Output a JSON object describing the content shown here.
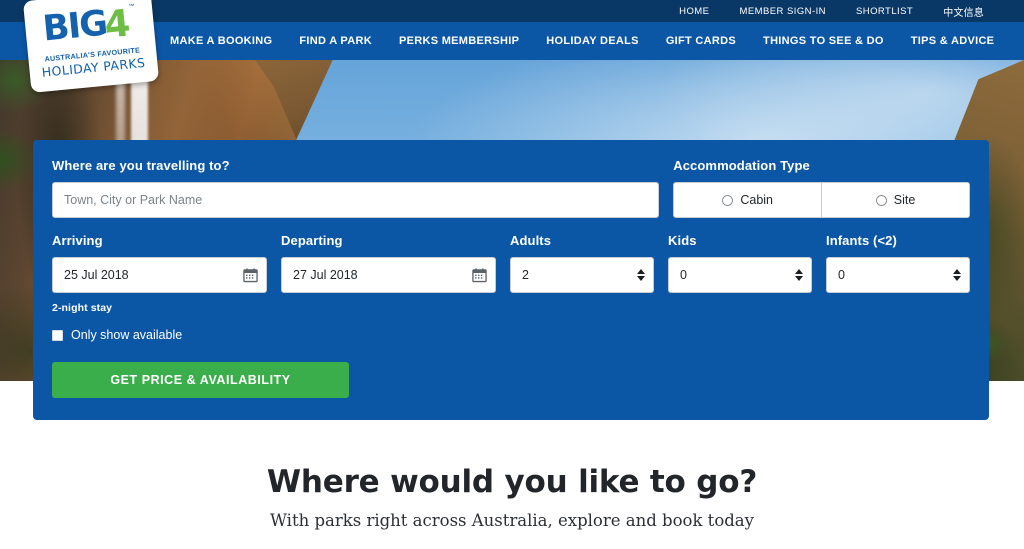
{
  "topbar": {
    "links": [
      {
        "label": "HOME",
        "name": "home"
      },
      {
        "label": "MEMBER SIGN-IN",
        "name": "member-sign-in"
      },
      {
        "label": "SHORTLIST",
        "name": "shortlist"
      },
      {
        "label": "中文信息",
        "name": "chinese-info"
      }
    ]
  },
  "mainnav": {
    "links": [
      {
        "label": "MAKE A BOOKING",
        "name": "make-a-booking"
      },
      {
        "label": "FIND A PARK",
        "name": "find-a-park"
      },
      {
        "label": "PERKS MEMBERSHIP",
        "name": "perks-membership"
      },
      {
        "label": "HOLIDAY DEALS",
        "name": "holiday-deals"
      },
      {
        "label": "GIFT CARDS",
        "name": "gift-cards"
      },
      {
        "label": "THINGS TO SEE & DO",
        "name": "things-to-see-and-do"
      },
      {
        "label": "TIPS & ADVICE",
        "name": "tips-and-advice"
      }
    ]
  },
  "logo": {
    "big": "BIG",
    "four": "4",
    "tm": "™",
    "tagline": "AUSTRALIA'S FAVOURITE",
    "subtitle": "HOLIDAY PARKS"
  },
  "booking": {
    "destination": {
      "label": "Where are you travelling to?",
      "value": "",
      "placeholder": "Town, City or Park Name"
    },
    "accommodation": {
      "label": "Accommodation Type",
      "options": [
        {
          "label": "Cabin",
          "selected": false
        },
        {
          "label": "Site",
          "selected": false
        }
      ]
    },
    "arriving": {
      "label": "Arriving",
      "value": "25 Jul 2018"
    },
    "departing": {
      "label": "Departing",
      "value": "27 Jul 2018"
    },
    "adults": {
      "label": "Adults",
      "value": "2"
    },
    "kids": {
      "label": "Kids",
      "value": "0"
    },
    "infants": {
      "label": "Infants (<2)",
      "value": "0"
    },
    "stay_note": "2-night stay",
    "only_available": {
      "label": "Only show available",
      "checked": false
    },
    "cta_label": "GET PRICE & AVAILABILITY"
  },
  "below": {
    "title": "Where would you like to go?",
    "subtitle": "With parks right across Australia, explore and book today"
  },
  "colors": {
    "top_bar_blue": "#0a3866",
    "nav_blue": "#0b57a6",
    "panel_blue": "#0b57a6",
    "cta_green": "#3aae4a",
    "logo_blue": "#1461ae",
    "logo_green": "#6cbe45"
  }
}
